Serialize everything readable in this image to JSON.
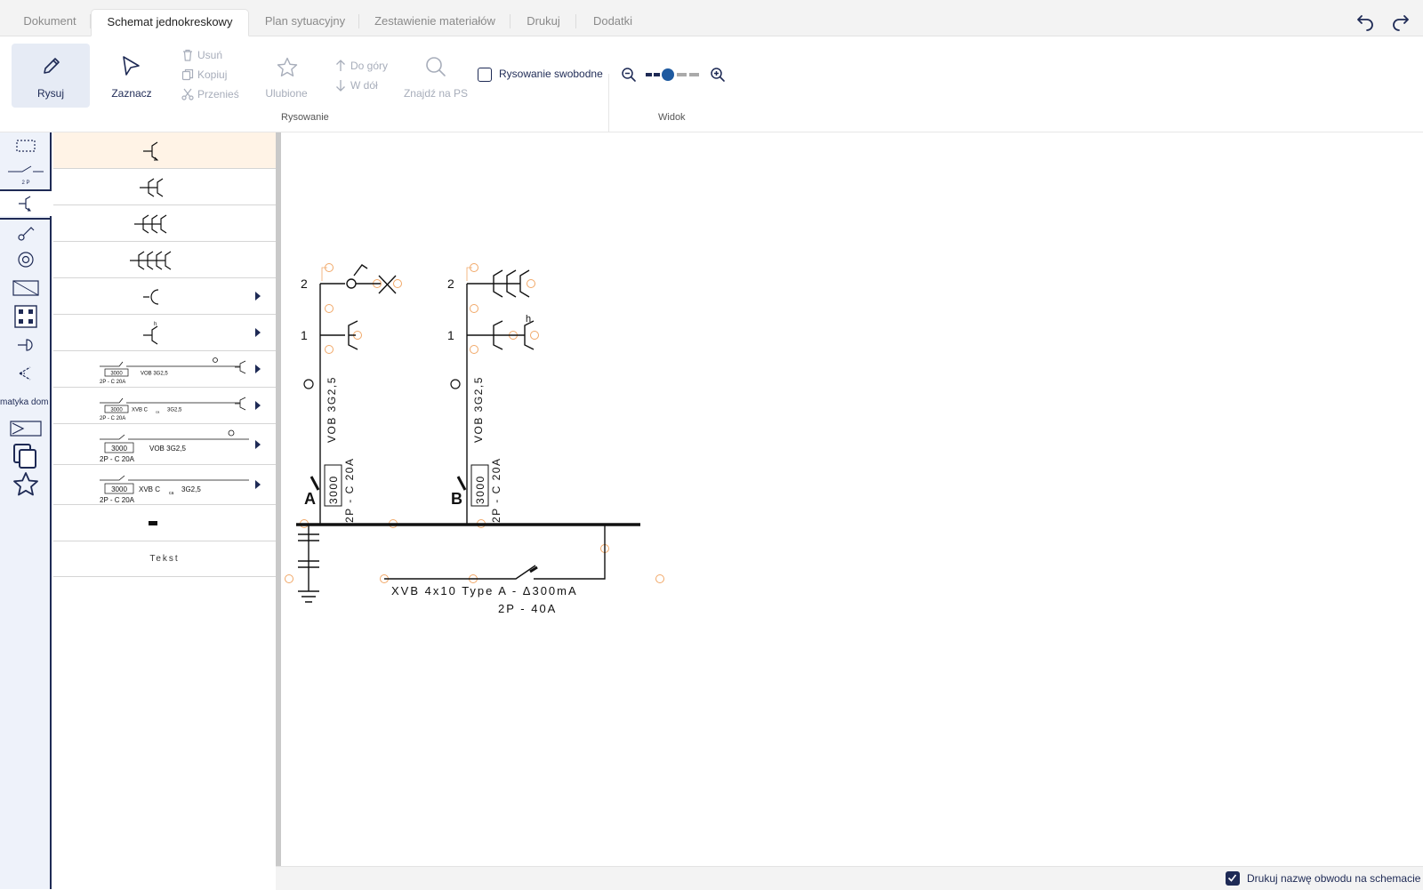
{
  "tabs": [
    {
      "label": "Dokument",
      "active": false
    },
    {
      "label": "Schemat jednokreskowy",
      "active": true
    },
    {
      "label": "Plan sytuacyjny",
      "active": false
    },
    {
      "label": "Zestawienie materiałów",
      "active": false
    },
    {
      "label": "Drukuj",
      "active": false
    },
    {
      "label": "Dodatki",
      "active": false
    }
  ],
  "toolbar": {
    "draw": "Rysuj",
    "select": "Zaznacz",
    "delete": "Usuń",
    "copy": "Kopiuj",
    "move": "Przenieś",
    "favorites": "Ulubione",
    "up": "Do góry",
    "down": "W dół",
    "find": "Znajdź na PS",
    "freehand": "Rysowanie swobodne",
    "group_drawing": "Rysowanie",
    "group_view": "Widok",
    "zoom_level_index": 1
  },
  "sidebar": {
    "icons": [
      "selection-rect-icon",
      "switch-2p-icon",
      "socket-icon",
      "lamp-switch-icon",
      "circle-icon",
      "device-icon",
      "box-icon",
      "plug-icon",
      "sensor-icon",
      "home-automation-icon",
      "block-icon",
      "copy-icon",
      "star-icon"
    ],
    "switch_label": "2 P",
    "home_automation": "matyka dom"
  },
  "library": {
    "text_label": "Tekst",
    "r7": {
      "num": "3000",
      "cable": "VOB  3G2,5",
      "prot": "2P - C 20A"
    },
    "r8": {
      "num": "3000",
      "cable": "XVB  C",
      "cable_sub": "ca",
      "cable_end": "3G2,5",
      "prot": "2P - C 20A"
    },
    "r9": {
      "num": "3000",
      "cable": "VOB  3G2,5",
      "prot": "2P - C 20A"
    },
    "r10": {
      "num": "3000",
      "cable": "XVB  C",
      "cable_sub": "ca",
      "cable_end": "3G2,5",
      "prot": "2P - C 20A"
    }
  },
  "schema": {
    "circuitA": {
      "letter": "A",
      "n2": "2",
      "n1": "1",
      "cable": "VOB  3G2,5",
      "num": "3000",
      "prot": "2P - C 20A"
    },
    "circuitB": {
      "letter": "B",
      "n2": "2",
      "n1": "1",
      "cable": "VOB  3G2,5",
      "num": "3000",
      "prot": "2P - C 20A",
      "h": "h"
    },
    "main_cable": "XVB  4x10 Type A - Δ300mA",
    "main_prot": "2P - 40A"
  },
  "status": {
    "print_circuit_name": "Drukuj nazwę obwodu na schemacie",
    "checked": true
  }
}
